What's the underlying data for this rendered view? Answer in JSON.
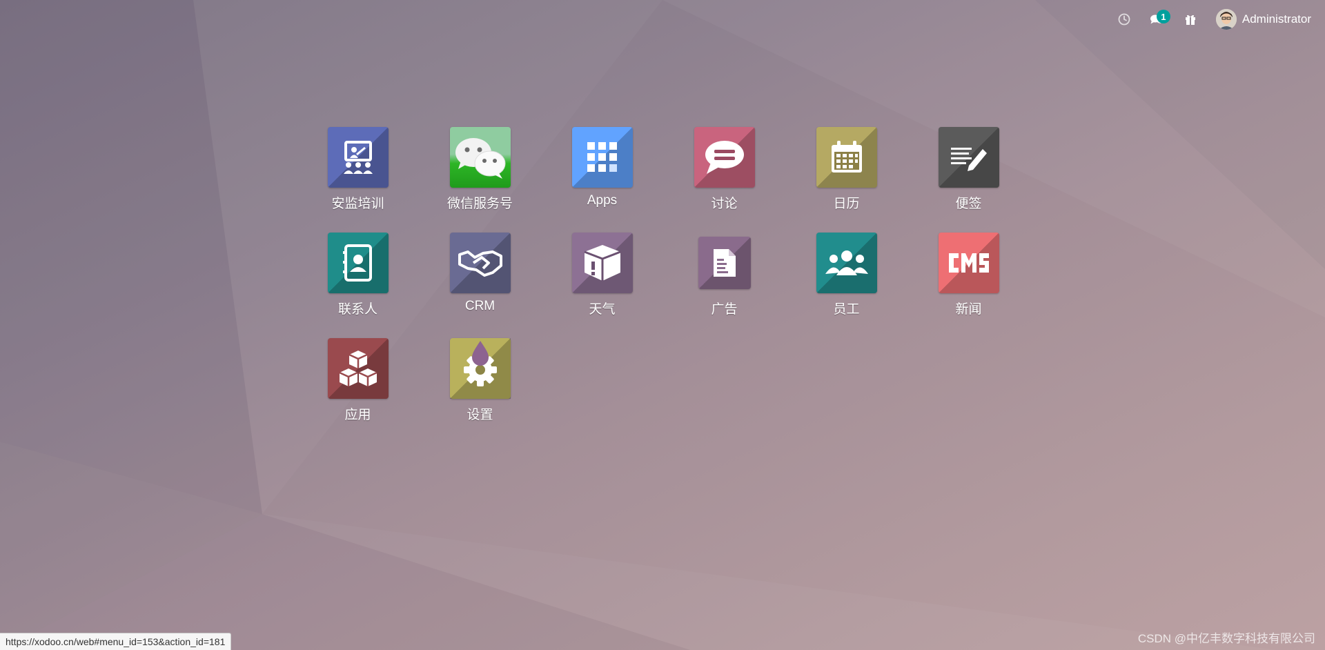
{
  "topbar": {
    "activity_icon": "clock-icon",
    "messages_icon": "chat-bubbles-icon",
    "messages_count": "1",
    "gift_icon": "gift-icon",
    "user_name": "Administrator"
  },
  "apps": [
    {
      "label": "安监培训",
      "icon": "presentation-icon",
      "color": "#5d6cb8"
    },
    {
      "label": "微信服务号",
      "icon": "wechat-icon",
      "color": "#2db526"
    },
    {
      "label": "Apps",
      "icon": "grid-icon",
      "color": "#61a3ff"
    },
    {
      "label": "讨论",
      "icon": "chat-icon",
      "color": "#c9647e"
    },
    {
      "label": "日历",
      "icon": "calendar-icon",
      "color": "#b5a963"
    },
    {
      "label": "便签",
      "icon": "note-pencil-icon",
      "color": "#5b5b5b"
    },
    {
      "label": "联系人",
      "icon": "address-book-icon",
      "color": "#1f8d8a"
    },
    {
      "label": "CRM",
      "icon": "handshake-icon",
      "color": "#6a6b93"
    },
    {
      "label": "天气",
      "icon": "package-alert-icon",
      "color": "#8d7194"
    },
    {
      "label": "广告",
      "icon": "document-icon",
      "color": "#8a6b8c"
    },
    {
      "label": "员工",
      "icon": "users-icon",
      "color": "#218d8d"
    },
    {
      "label": "新闻",
      "icon": "cms-icon",
      "color": "#ee6f73"
    },
    {
      "label": "应用",
      "icon": "cubes-icon",
      "color": "#9a4a4e"
    },
    {
      "label": "设置",
      "icon": "gear-drop-icon",
      "color": "#b9b15c"
    }
  ],
  "status_url": "https://xodoo.cn/web#menu_id=153&action_id=181",
  "watermark": "CSDN @中亿丰数字科技有限公司"
}
